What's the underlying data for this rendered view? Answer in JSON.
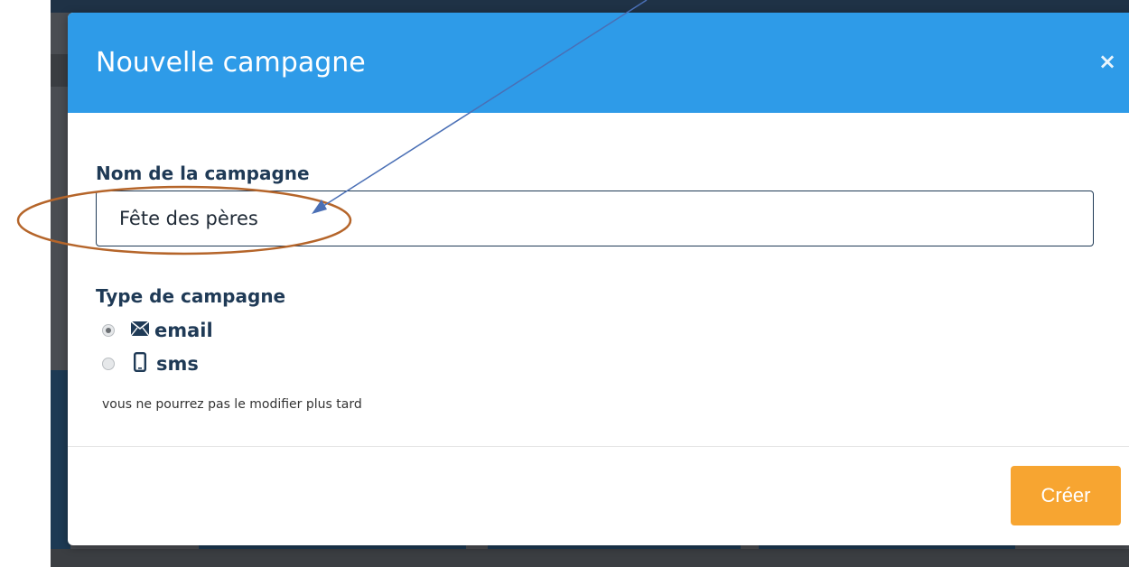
{
  "modal": {
    "title": "Nouvelle campagne",
    "close_label": "×",
    "name_label": "Nom de la campagne",
    "name_value": "Fête des pères",
    "type_label": "Type de campagne",
    "options": [
      {
        "label": "email",
        "icon": "envelope-icon",
        "checked": true
      },
      {
        "label": "sms",
        "icon": "mobile-phone-icon",
        "checked": false
      }
    ],
    "help_text": "vous ne pourrez pas le modifier plus tard",
    "create_label": "Créer"
  },
  "colors": {
    "header": "#2e9be8",
    "accent_button": "#f7a531",
    "label_text": "#1f3a56",
    "annotation_ellipse": "#b5652a",
    "annotation_arrow": "#4a6fb5"
  }
}
